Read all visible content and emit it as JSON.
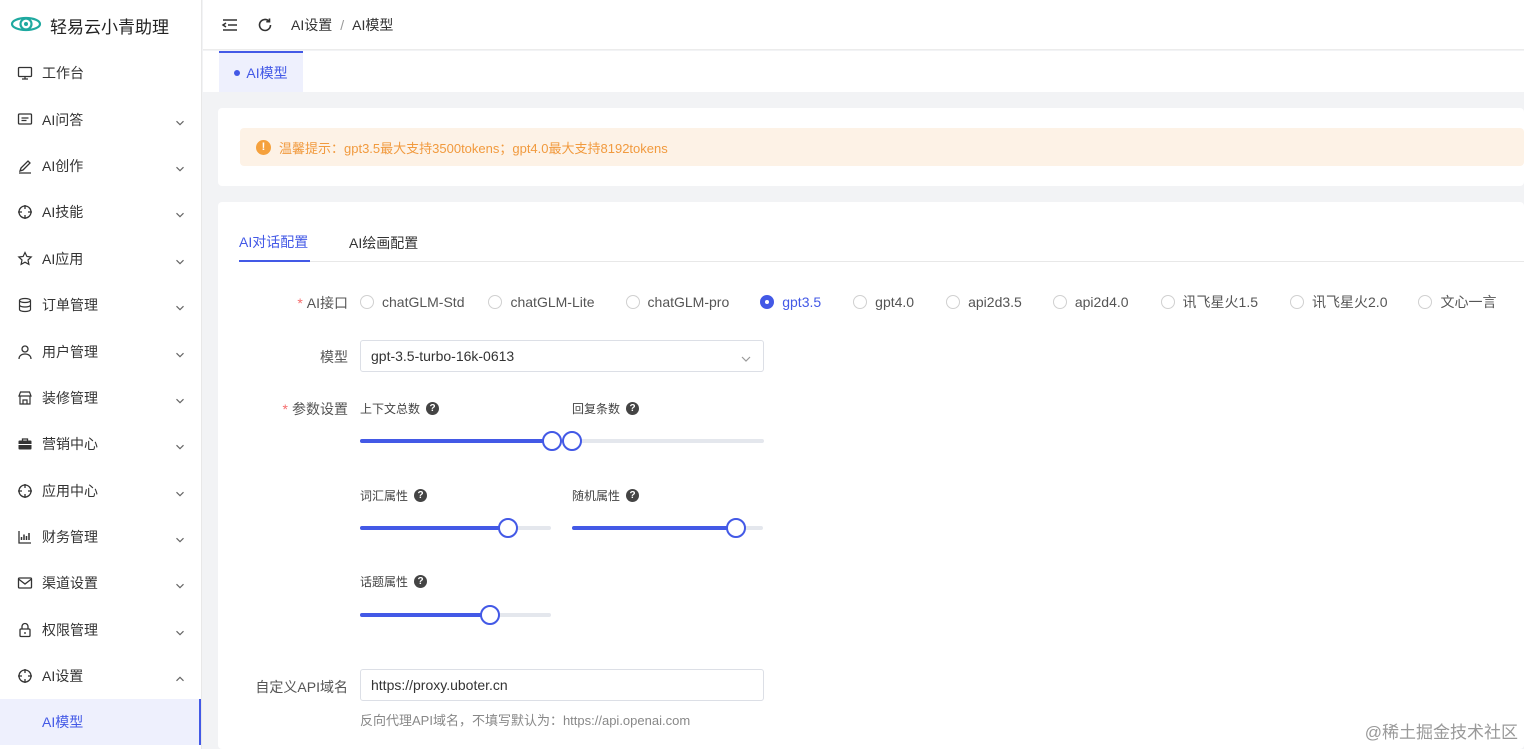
{
  "app": {
    "name": "轻易云小青助理"
  },
  "sidebar": {
    "items": [
      {
        "label": "工作台",
        "icon": "monitor-icon",
        "has_children": false
      },
      {
        "label": "AI问答",
        "icon": "message-icon",
        "has_children": true
      },
      {
        "label": "AI创作",
        "icon": "pen-icon",
        "has_children": true
      },
      {
        "label": "AI技能",
        "icon": "target-icon",
        "has_children": true
      },
      {
        "label": "AI应用",
        "icon": "star-icon",
        "has_children": true
      },
      {
        "label": "订单管理",
        "icon": "database-icon",
        "has_children": true
      },
      {
        "label": "用户管理",
        "icon": "user-icon",
        "has_children": true
      },
      {
        "label": "装修管理",
        "icon": "shop-icon",
        "has_children": true
      },
      {
        "label": "营销中心",
        "icon": "briefcase-icon",
        "has_children": true
      },
      {
        "label": "应用中心",
        "icon": "target-icon",
        "has_children": true
      },
      {
        "label": "财务管理",
        "icon": "chart-icon",
        "has_children": true
      },
      {
        "label": "渠道设置",
        "icon": "mail-icon",
        "has_children": true
      },
      {
        "label": "权限管理",
        "icon": "lock-icon",
        "has_children": true
      },
      {
        "label": "AI设置",
        "icon": "target-icon",
        "has_children": true,
        "expanded": true
      }
    ],
    "active_sub_item": "AI模型"
  },
  "header": {
    "breadcrumb": [
      "AI设置",
      "AI模型"
    ],
    "separator": "/"
  },
  "page_tab": {
    "label": "AI模型"
  },
  "alert": {
    "text": "温馨提示：gpt3.5最大支持3500tokens；gpt4.0最大支持8192tokens"
  },
  "tabs": {
    "items": [
      "AI对话配置",
      "AI绘画配置"
    ],
    "active": 0
  },
  "form": {
    "api_label": "AI接口",
    "api_options": [
      "chatGLM-Std",
      "chatGLM-Lite",
      "chatGLM-pro",
      "gpt3.5",
      "gpt4.0",
      "api2d3.5",
      "api2d4.0",
      "讯飞星火1.5",
      "讯飞星火2.0",
      "文心一言"
    ],
    "api_selected": "gpt3.5",
    "model_label": "模型",
    "model_value": "gpt-3.5-turbo-16k-0613",
    "params_label": "参数设置",
    "params": {
      "context_total": {
        "label": "上下文总数",
        "value_percent": 47.5
      },
      "reply_count": {
        "label": "回复条数",
        "value_percent": 0
      },
      "vocab": {
        "label": "词汇属性",
        "value_percent": 80.5
      },
      "random": {
        "label": "随机属性",
        "value_percent": 90
      },
      "topic": {
        "label": "话题属性",
        "value_percent": 70
      }
    },
    "api_domain_label": "自定义API域名",
    "api_domain_value": "https://proxy.uboter.cn",
    "api_domain_hint": "反向代理API域名，不填写默认为：https://api.openai.com"
  },
  "watermark": "@稀土掘金技术社区",
  "colors": {
    "accent": "#4359e6",
    "warning": "#f19a3e",
    "warning_bg": "#fdf2e6"
  }
}
